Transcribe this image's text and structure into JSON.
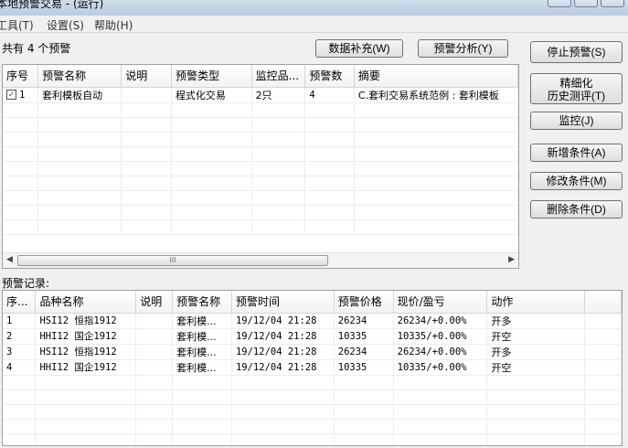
{
  "window": {
    "title": "本地预警交易 - (运行)"
  },
  "menu": [
    "工具(T)",
    "设置(S)",
    "帮助(H)"
  ],
  "summary": {
    "count_label": "共有 4 个预警"
  },
  "toolbar": {
    "supplement_label": "数据补充(W)",
    "analysis_label": "预警分析(Y)"
  },
  "side_buttons": {
    "stop": "停止预警(S)",
    "backtest_line1": "精细化",
    "backtest_line2": "历史测评(T)",
    "monitor": "监控(J)",
    "add": "新增条件(A)",
    "modify": "修改条件(M)",
    "delete": "删除条件(D)"
  },
  "alerts_table": {
    "columns": [
      "序号",
      "预警名称",
      "说明",
      "预警类型",
      "监控品...",
      "预警数",
      "摘要"
    ],
    "rows": [
      {
        "checked": true,
        "index": "1",
        "name": "套利模板自动",
        "desc": "",
        "type": "程式化交易",
        "monitored": "2只",
        "count": "4",
        "summary": "C.套利交易系统范例 : 套利模板"
      }
    ]
  },
  "scroll_grip": "III",
  "records": {
    "label": "预警记录:",
    "columns": [
      "序...",
      "品种名称",
      "说明",
      "预警名称",
      "预警时间",
      "预警价格",
      "现价/盈亏",
      "动作"
    ],
    "rows": [
      {
        "index": "1",
        "product": "HSI12 恒指1912",
        "desc": "",
        "alert": "套利模...",
        "time": "19/12/04 21:28",
        "price": "26234",
        "pnl": "26234/+0.00%",
        "action": "开多"
      },
      {
        "index": "2",
        "product": "HHI12 国企1912",
        "desc": "",
        "alert": "套利模...",
        "time": "19/12/04 21:28",
        "price": "10335",
        "pnl": "10335/+0.00%",
        "action": "开空"
      },
      {
        "index": "3",
        "product": "HSI12 恒指1912",
        "desc": "",
        "alert": "套利模...",
        "time": "19/12/04 21:28",
        "price": "26234",
        "pnl": "26234/+0.00%",
        "action": "开多"
      },
      {
        "index": "4",
        "product": "HHI12 国企1912",
        "desc": "",
        "alert": "套利模...",
        "time": "19/12/04 21:28",
        "price": "10335",
        "pnl": "10335/+0.00%",
        "action": "开空"
      }
    ]
  }
}
